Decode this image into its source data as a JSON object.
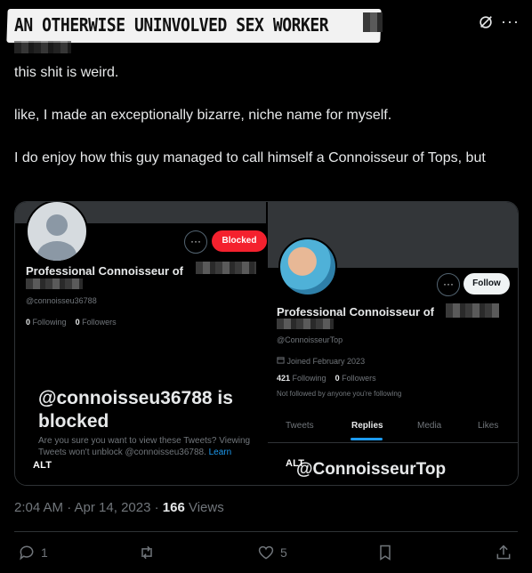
{
  "tweet": {
    "author_name": "AN OTHERWISE UNINVOLVED SEX WORKER",
    "text": [
      "this shit is weird.",
      "like, I made an exceptionally bizarre, niche name for myself.",
      "I do enjoy how this guy managed to call himself a Connoisseur of Tops, but"
    ],
    "timestamp": "2:04 AM · Apr 14, 2023 · ",
    "views_count": "166",
    "views_label": " Views"
  },
  "media": {
    "left": {
      "blocked_button": "Blocked",
      "more": "···",
      "display_name": "Professional Connoisseur of",
      "handle": "@connoisseu36788",
      "following_count": "0",
      "following_label": " Following",
      "followers_count": "0",
      "followers_label": " Followers",
      "blocked_title": "@connoisseu36788 is blocked",
      "blocked_desc": "Are you sure you want to view these Tweets? Viewing Tweets won't unblock @connoisseu36788.",
      "learn_more": " Learn",
      "alt": "ALT"
    },
    "right": {
      "follow_button": "Follow",
      "more": "···",
      "display_name": "Professional Connoisseur of",
      "handle": "@ConnoisseurTop",
      "joined": "Joined February 2023",
      "following_count": "421",
      "following_label": " Following",
      "followers_count": "0",
      "followers_label": " Followers",
      "not_followed": "Not followed by anyone you're following",
      "tabs": [
        "Tweets",
        "Replies",
        "Media",
        "Likes"
      ],
      "big_handle": "@ConnoisseurTop",
      "alt": "ALT"
    }
  },
  "actions": {
    "reply_count": "1",
    "retweet_count": "",
    "like_count": "5"
  },
  "colors": {
    "background": "#000000",
    "text": "#e7e9ea",
    "muted": "#71767b",
    "accent": "#1d9bf0",
    "blocked": "#f4212e"
  }
}
